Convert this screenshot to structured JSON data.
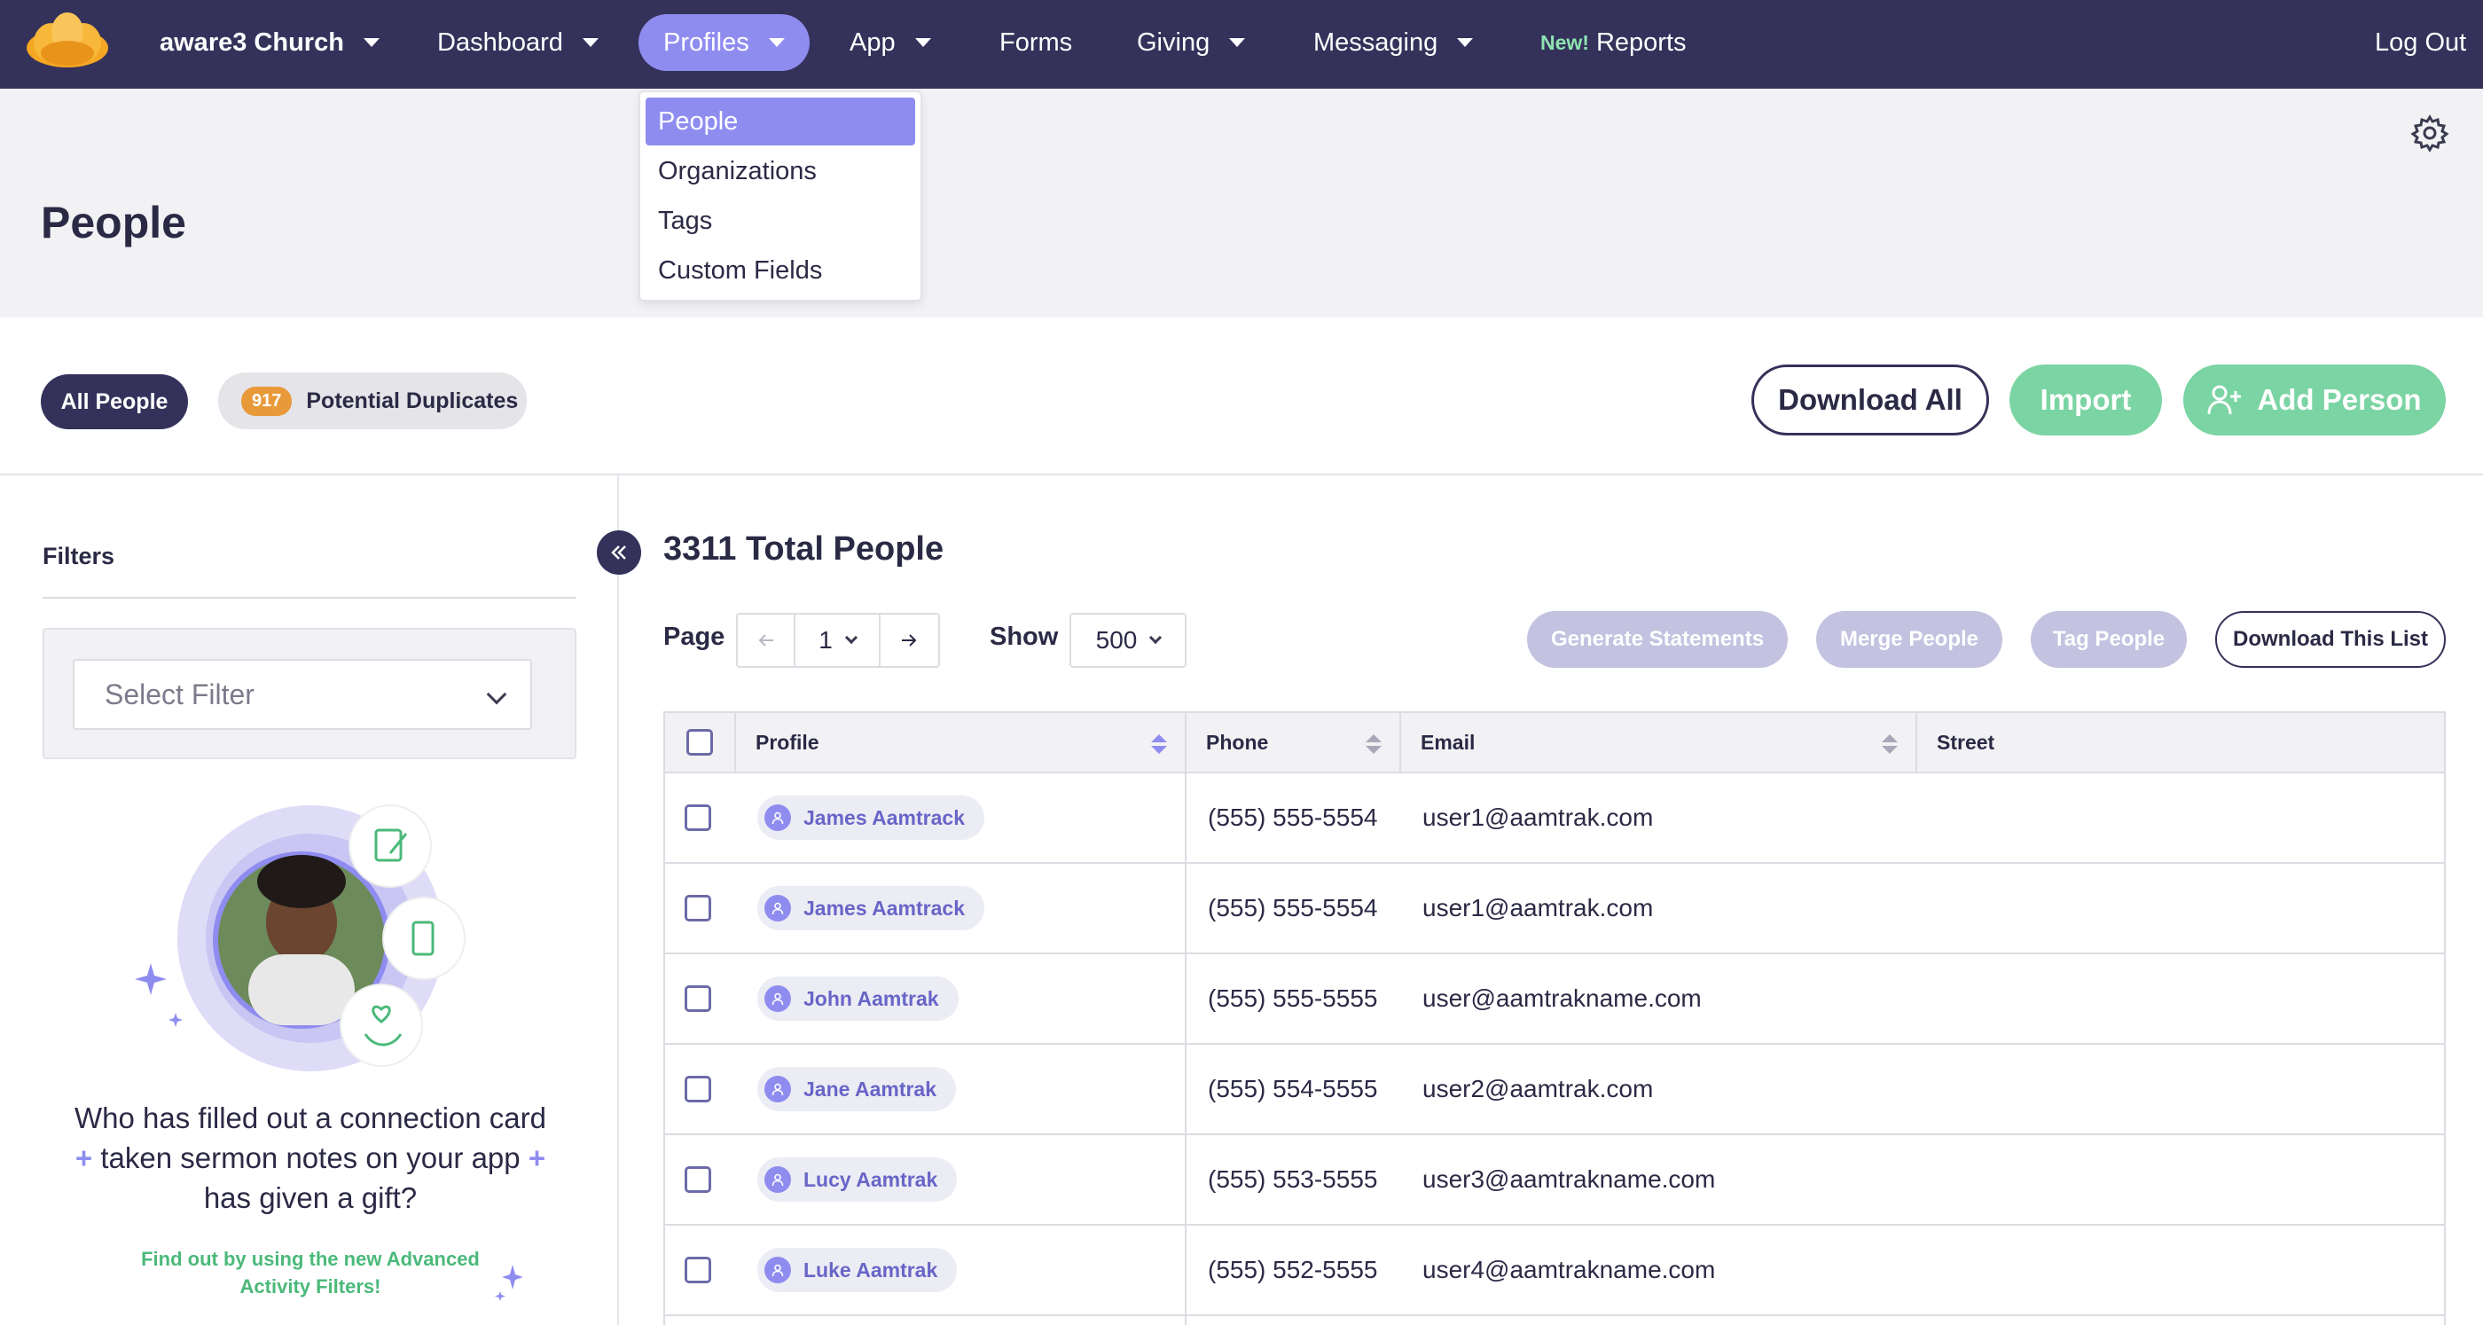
{
  "nav": {
    "brand": "aware3 Church",
    "items": [
      {
        "label": "Dashboard"
      },
      {
        "label": "Profiles"
      },
      {
        "label": "App"
      },
      {
        "label": "Forms"
      },
      {
        "label": "Giving"
      },
      {
        "label": "Messaging"
      }
    ],
    "new_badge": "New!",
    "reports": "Reports",
    "logout": "Log Out"
  },
  "profiles_menu": {
    "items": [
      "People",
      "Organizations",
      "Tags",
      "Custom Fields"
    ],
    "active": "People"
  },
  "header": {
    "title": "People"
  },
  "toolbar": {
    "all_people": "All People",
    "duplicates_count": "917",
    "duplicates_label": "Potential Duplicates",
    "download_all": "Download All",
    "import": "Import",
    "add_person": "Add Person"
  },
  "sidebar": {
    "filters_label": "Filters",
    "select_filter_placeholder": "Select Filter",
    "promo_line1": "Who has filled out a connection card",
    "promo_line2": "taken sermon notes on your app",
    "promo_line3": "has given a gift?",
    "promo_plus": "+",
    "promo_sub": "Find out by using the new Advanced Activity Filters!"
  },
  "main": {
    "total": "3311 Total People",
    "page_label": "Page",
    "page_value": "1",
    "show_label": "Show",
    "show_value": "500",
    "actions": {
      "generate": "Generate Statements",
      "merge": "Merge People",
      "tag": "Tag People",
      "download_list": "Download This List"
    }
  },
  "table": {
    "columns": [
      "Profile",
      "Phone",
      "Email",
      "Street"
    ],
    "rows": [
      {
        "name": "James Aamtrack",
        "phone": "(555) 555-5554",
        "email": "user1@aamtrak.com"
      },
      {
        "name": "James Aamtrack",
        "phone": "(555) 555-5554",
        "email": "user1@aamtrak.com"
      },
      {
        "name": "John Aamtrak",
        "phone": "(555) 555-5555",
        "email": "user@aamtrakname.com"
      },
      {
        "name": "Jane Aamtrak",
        "phone": "(555) 554-5555",
        "email": "user2@aamtrak.com"
      },
      {
        "name": "Lucy Aamtrak",
        "phone": "(555) 553-5555",
        "email": "user3@aamtrakname.com"
      },
      {
        "name": "Luke Aamtrak",
        "phone": "(555) 552-5555",
        "email": "user4@aamtrakname.com"
      }
    ]
  },
  "colors": {
    "nav_bg": "#34325a",
    "accent": "#8f8cf0",
    "green": "#7bd4a3",
    "badge_orange": "#e89a3a"
  }
}
